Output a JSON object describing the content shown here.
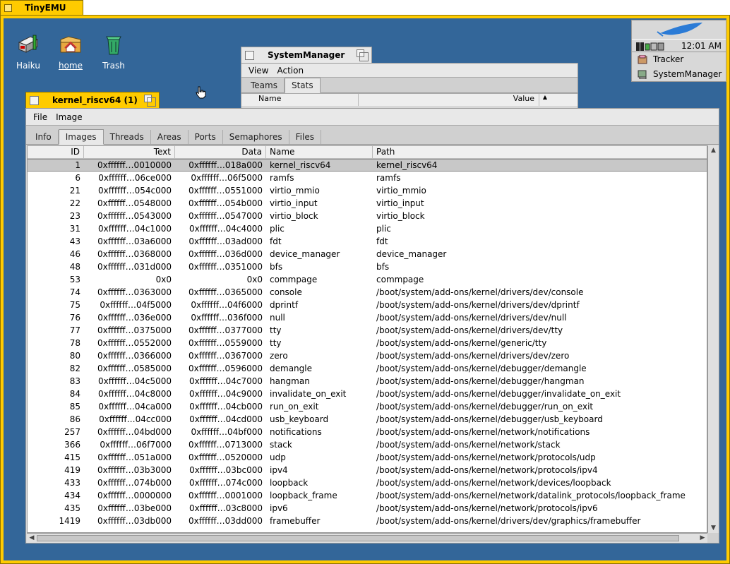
{
  "outer_window": {
    "title": "TinyEMU"
  },
  "desktop": {
    "icons": [
      {
        "label": "Haiku"
      },
      {
        "label": "home"
      },
      {
        "label": "Trash"
      }
    ]
  },
  "deskbar": {
    "clock": "12:01 AM",
    "items": [
      {
        "label": "Tracker"
      },
      {
        "label": "SystemManager"
      }
    ]
  },
  "system_manager": {
    "title": "SystemManager",
    "menu": [
      "View",
      "Action"
    ],
    "tabs": [
      "Teams",
      "Stats"
    ],
    "active_tab": "Stats",
    "columns": [
      "Name",
      "Value"
    ]
  },
  "kernel_window": {
    "title": "kernel_riscv64 (1)",
    "menu": [
      "File",
      "Image"
    ],
    "tabs": [
      "Info",
      "Images",
      "Threads",
      "Areas",
      "Ports",
      "Semaphores",
      "Files"
    ],
    "active_tab": "Images",
    "columns": [
      "ID",
      "Text",
      "Data",
      "Name",
      "Path"
    ],
    "rows": [
      {
        "id": "1",
        "text": "0xffffff…0010000",
        "data": "0xffffff…018a000",
        "name": "kernel_riscv64",
        "path": "kernel_riscv64"
      },
      {
        "id": "6",
        "text": "0xffffff…06ce000",
        "data": "0xffffff…06f5000",
        "name": "ramfs",
        "path": "ramfs"
      },
      {
        "id": "21",
        "text": "0xffffff…054c000",
        "data": "0xffffff…0551000",
        "name": "virtio_mmio",
        "path": "virtio_mmio"
      },
      {
        "id": "22",
        "text": "0xffffff…0548000",
        "data": "0xffffff…054b000",
        "name": "virtio_input",
        "path": "virtio_input"
      },
      {
        "id": "23",
        "text": "0xffffff…0543000",
        "data": "0xffffff…0547000",
        "name": "virtio_block",
        "path": "virtio_block"
      },
      {
        "id": "31",
        "text": "0xffffff…04c1000",
        "data": "0xffffff…04c4000",
        "name": "plic",
        "path": "plic"
      },
      {
        "id": "43",
        "text": "0xffffff…03a6000",
        "data": "0xffffff…03ad000",
        "name": "fdt",
        "path": "fdt"
      },
      {
        "id": "46",
        "text": "0xffffff…0368000",
        "data": "0xffffff…036d000",
        "name": "device_manager",
        "path": "device_manager"
      },
      {
        "id": "48",
        "text": "0xffffff…031d000",
        "data": "0xffffff…0351000",
        "name": "bfs",
        "path": "bfs"
      },
      {
        "id": "53",
        "text": "0x0",
        "data": "0x0",
        "name": "commpage",
        "path": "commpage"
      },
      {
        "id": "74",
        "text": "0xffffff…0363000",
        "data": "0xffffff…0365000",
        "name": "console",
        "path": "/boot/system/add-ons/kernel/drivers/dev/console"
      },
      {
        "id": "75",
        "text": "0xffffff…04f5000",
        "data": "0xffffff…04f6000",
        "name": "dprintf",
        "path": "/boot/system/add-ons/kernel/drivers/dev/dprintf"
      },
      {
        "id": "76",
        "text": "0xffffff…036e000",
        "data": "0xffffff…036f000",
        "name": "null",
        "path": "/boot/system/add-ons/kernel/drivers/dev/null"
      },
      {
        "id": "77",
        "text": "0xffffff…0375000",
        "data": "0xffffff…0377000",
        "name": "tty",
        "path": "/boot/system/add-ons/kernel/drivers/dev/tty"
      },
      {
        "id": "78",
        "text": "0xffffff…0552000",
        "data": "0xffffff…0559000",
        "name": "tty",
        "path": "/boot/system/add-ons/kernel/generic/tty"
      },
      {
        "id": "80",
        "text": "0xffffff…0366000",
        "data": "0xffffff…0367000",
        "name": "zero",
        "path": "/boot/system/add-ons/kernel/drivers/dev/zero"
      },
      {
        "id": "82",
        "text": "0xffffff…0585000",
        "data": "0xffffff…0596000",
        "name": "demangle",
        "path": "/boot/system/add-ons/kernel/debugger/demangle"
      },
      {
        "id": "83",
        "text": "0xffffff…04c5000",
        "data": "0xffffff…04c7000",
        "name": "hangman",
        "path": "/boot/system/add-ons/kernel/debugger/hangman"
      },
      {
        "id": "84",
        "text": "0xffffff…04c8000",
        "data": "0xffffff…04c9000",
        "name": "invalidate_on_exit",
        "path": "/boot/system/add-ons/kernel/debugger/invalidate_on_exit"
      },
      {
        "id": "85",
        "text": "0xffffff…04ca000",
        "data": "0xffffff…04cb000",
        "name": "run_on_exit",
        "path": "/boot/system/add-ons/kernel/debugger/run_on_exit"
      },
      {
        "id": "86",
        "text": "0xffffff…04cc000",
        "data": "0xffffff…04cd000",
        "name": "usb_keyboard",
        "path": "/boot/system/add-ons/kernel/debugger/usb_keyboard"
      },
      {
        "id": "257",
        "text": "0xffffff…04bd000",
        "data": "0xffffff…04bf000",
        "name": "notifications",
        "path": "/boot/system/add-ons/kernel/network/notifications"
      },
      {
        "id": "366",
        "text": "0xffffff…06f7000",
        "data": "0xffffff…0713000",
        "name": "stack",
        "path": "/boot/system/add-ons/kernel/network/stack"
      },
      {
        "id": "415",
        "text": "0xffffff…051a000",
        "data": "0xffffff…0520000",
        "name": "udp",
        "path": "/boot/system/add-ons/kernel/network/protocols/udp"
      },
      {
        "id": "419",
        "text": "0xffffff…03b3000",
        "data": "0xffffff…03bc000",
        "name": "ipv4",
        "path": "/boot/system/add-ons/kernel/network/protocols/ipv4"
      },
      {
        "id": "433",
        "text": "0xffffff…074b000",
        "data": "0xffffff…074c000",
        "name": "loopback",
        "path": "/boot/system/add-ons/kernel/network/devices/loopback"
      },
      {
        "id": "434",
        "text": "0xffffff…0000000",
        "data": "0xffffff…0001000",
        "name": "loopback_frame",
        "path": "/boot/system/add-ons/kernel/network/datalink_protocols/loopback_frame"
      },
      {
        "id": "435",
        "text": "0xffffff…03be000",
        "data": "0xffffff…03c8000",
        "name": "ipv6",
        "path": "/boot/system/add-ons/kernel/network/protocols/ipv6"
      },
      {
        "id": "1419",
        "text": "0xffffff…03db000",
        "data": "0xffffff…03dd000",
        "name": "framebuffer",
        "path": "/boot/system/add-ons/kernel/drivers/dev/graphics/framebuffer"
      }
    ],
    "selected_row": 0
  },
  "colors": {
    "desktop": "#336699",
    "window_tab_active": "#ffcb00",
    "window_body": "#d8d8d8"
  }
}
